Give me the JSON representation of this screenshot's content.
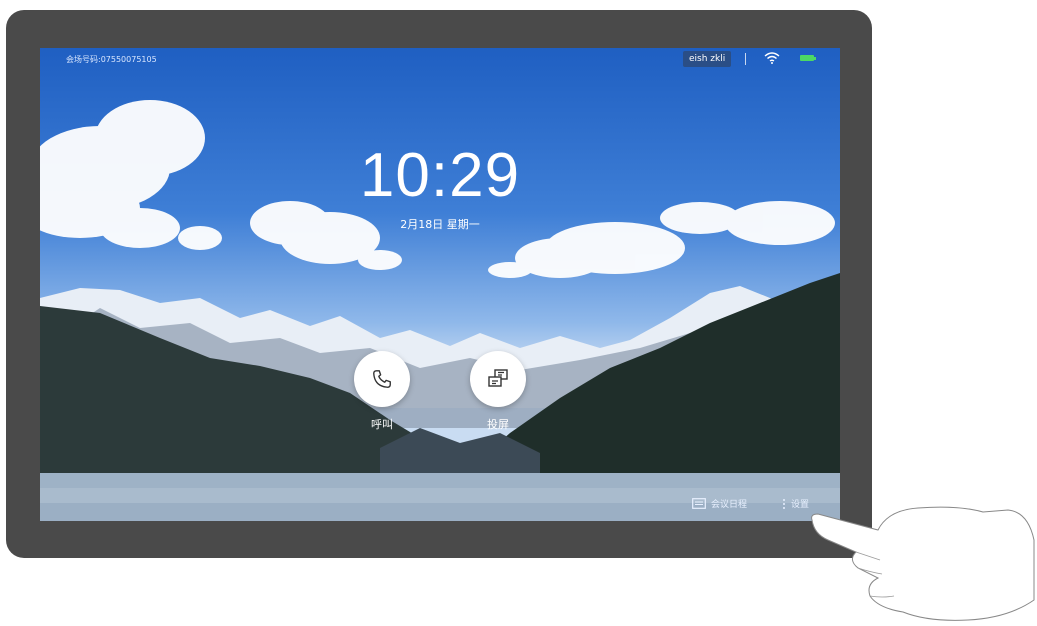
{
  "screen": {
    "meeting_id": "会场号码:07550075105",
    "user_name": "eish zkli",
    "time": "10:29",
    "date": "2月18日 星期一"
  },
  "actions": {
    "call_label": "呼叫",
    "share_label": "投屏"
  },
  "bottom_bar": {
    "schedule_label": "会议日程",
    "settings_label": "设置"
  },
  "colors": {
    "bezel": "#4a4a4a",
    "battery": "#4cd964",
    "user_chip": "#2a4e86"
  }
}
